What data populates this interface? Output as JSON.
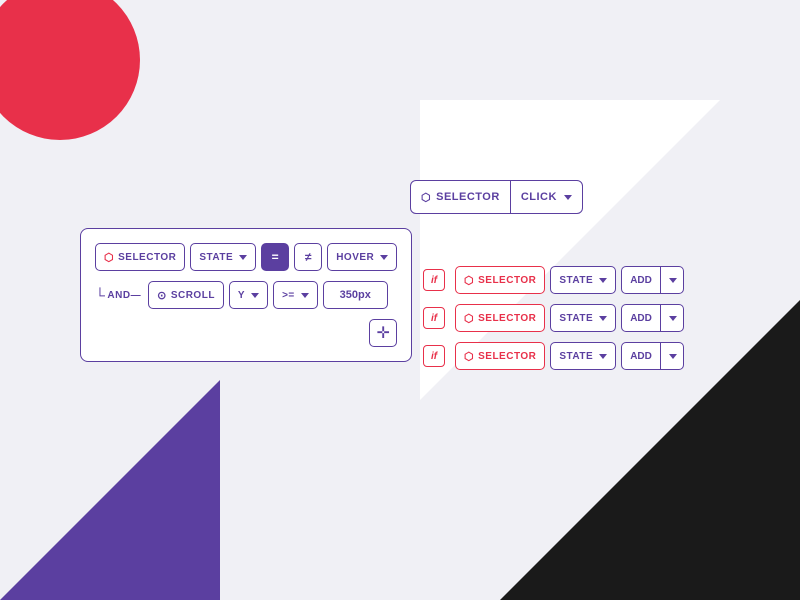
{
  "background": {
    "circle_color": "#e8304a",
    "triangle_black": "#1a1a1a",
    "triangle_purple": "#5b3fa0",
    "triangle_white": "#ffffff"
  },
  "selector_click_bar": {
    "selector_label": "SELECTOR",
    "click_label": "CLICK",
    "chevron": "▾"
  },
  "condition_box": {
    "row1": {
      "selector_label": "SELECTOR",
      "state_label": "STATE",
      "eq_op": "=",
      "neq_op": "≠",
      "value_label": "HOVER"
    },
    "row2": {
      "and_label": "AND—",
      "scroll_label": "SCROLL",
      "y_label": "Y",
      "gte_op": ">=",
      "value": "350px"
    },
    "add_btn": "+"
  },
  "right_rows": [
    {
      "if_label": "if",
      "selector_label": "SELECTOR",
      "state_label": "STATE",
      "add_label": "ADD"
    },
    {
      "if_label": "if",
      "selector_label": "SELECTOR",
      "state_label": "STATE",
      "add_label": "ADD"
    },
    {
      "if_label": "if",
      "selector_label": "SELECTOR",
      "state_label": "STATE",
      "add_label": "ADD"
    }
  ]
}
